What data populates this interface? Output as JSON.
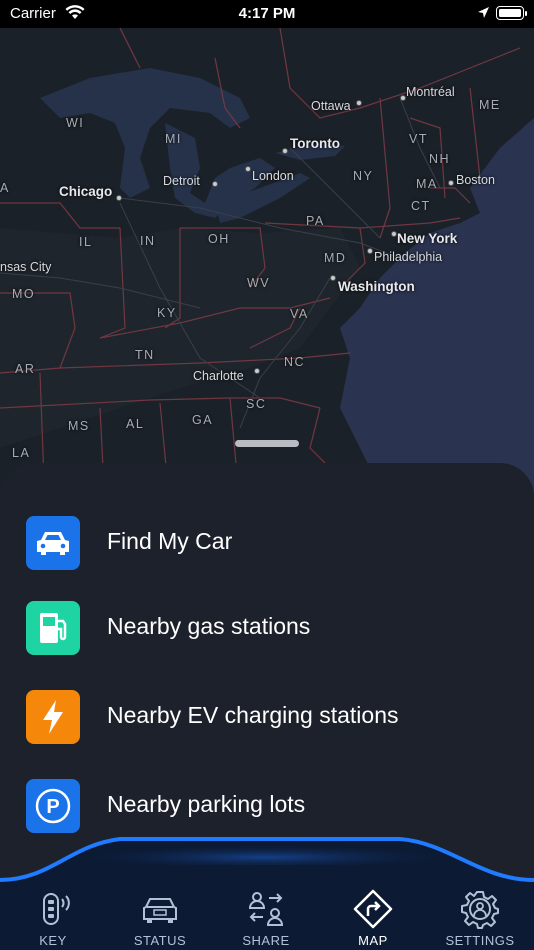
{
  "status_bar": {
    "carrier": "Carrier",
    "time": "4:17 PM"
  },
  "map": {
    "labels": {
      "wi": "WI",
      "mi": "MI",
      "a": "A",
      "chicago": "Chicago",
      "detroit": "Detroit",
      "ottawa": "Ottawa",
      "montreal": "Montréal",
      "me": "ME",
      "toronto": "Toronto",
      "london": "London",
      "vt": "VT",
      "nh": "NH",
      "ny": "NY",
      "ma": "MA",
      "boston": "Boston",
      "ct": "CT",
      "il": "IL",
      "in": "IN",
      "oh": "OH",
      "pa": "PA",
      "new_york": "New York",
      "kansas_city": "nsas City",
      "md": "MD",
      "philadelphia": "Philadelphia",
      "mo": "MO",
      "wv": "WV",
      "washington": "Washington",
      "ky": "KY",
      "va": "VA",
      "tn": "TN",
      "nc": "NC",
      "ar": "AR",
      "charlotte": "Charlotte",
      "ga": "GA",
      "sc": "SC",
      "ms": "MS",
      "al": "AL",
      "la": "LA"
    }
  },
  "menu": [
    {
      "label": "Find My Car",
      "icon": "car-icon",
      "color": "#1a73e8"
    },
    {
      "label": "Nearby gas stations",
      "icon": "gas-pump-icon",
      "color": "#1ed4a3"
    },
    {
      "label": "Nearby EV charging stations",
      "icon": "lightning-bolt-icon",
      "color": "#f5870a"
    },
    {
      "label": "Nearby parking lots",
      "icon": "parking-icon",
      "color": "#1a73e8"
    }
  ],
  "tabs": [
    {
      "label": "KEY",
      "icon": "car-key-icon"
    },
    {
      "label": "STATUS",
      "icon": "car-status-icon"
    },
    {
      "label": "SHARE",
      "icon": "share-users-icon"
    },
    {
      "label": "MAP",
      "icon": "directions-icon",
      "active": true
    },
    {
      "label": "SETTINGS",
      "icon": "gear-icon"
    }
  ],
  "colors": {
    "accent": "#1a73e8",
    "tabbar": "#0c1a33",
    "sheet": "#1d212c"
  }
}
